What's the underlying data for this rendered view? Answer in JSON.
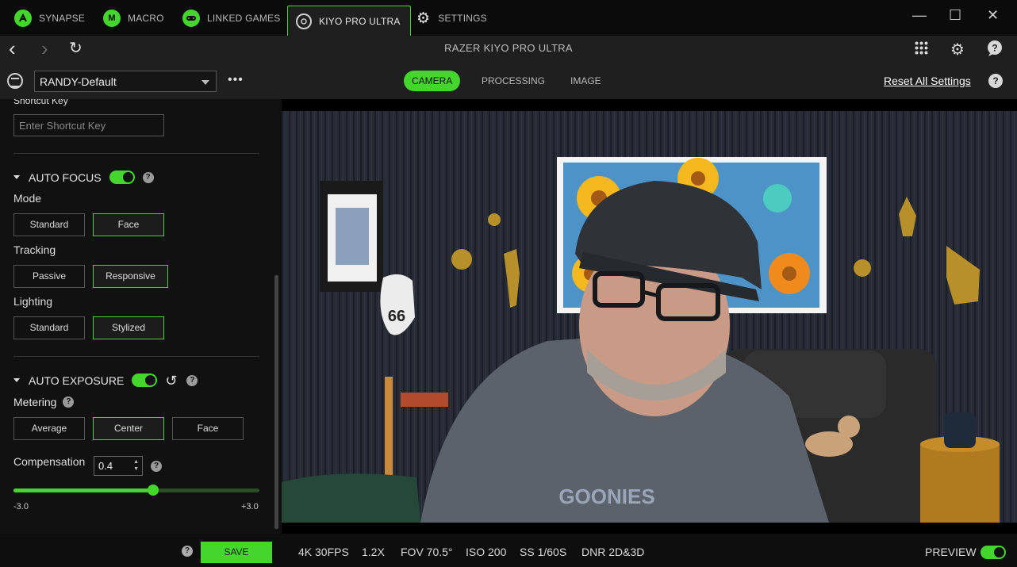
{
  "app_tabs": [
    {
      "label": "SYNAPSE",
      "icon": "razer-snake-icon"
    },
    {
      "label": "MACRO",
      "icon": "macro-m-icon"
    },
    {
      "label": "LINKED GAMES",
      "icon": "gamepad-icon"
    },
    {
      "label": "KIYO PRO ULTRA",
      "icon": "webcam-icon"
    },
    {
      "label": "SETTINGS",
      "icon": "gear-icon"
    }
  ],
  "window": {
    "minimize": "—",
    "maximize": "☐",
    "close": "✕"
  },
  "nav": {
    "title": "RAZER KIYO PRO ULTRA",
    "back": "‹",
    "forward": "›",
    "refresh": "↻"
  },
  "profile": {
    "selected": "RANDY-Default",
    "more": "•••",
    "tabs": [
      "CAMERA",
      "PROCESSING",
      "IMAGE"
    ],
    "active_tab": "CAMERA",
    "reset_label": "Reset All Settings"
  },
  "sidebar": {
    "shortcut": {
      "label": "Shortcut Key",
      "placeholder": "Enter Shortcut Key"
    },
    "auto_focus": {
      "title": "AUTO FOCUS",
      "enabled": true,
      "mode": {
        "label": "Mode",
        "options": [
          "Standard",
          "Face"
        ],
        "selected": "Face"
      },
      "tracking": {
        "label": "Tracking",
        "options": [
          "Passive",
          "Responsive"
        ],
        "selected": "Responsive"
      },
      "lighting": {
        "label": "Lighting",
        "options": [
          "Standard",
          "Stylized"
        ],
        "selected": "Stylized"
      }
    },
    "auto_exposure": {
      "title": "AUTO EXPOSURE",
      "enabled": true,
      "metering": {
        "label": "Metering",
        "options": [
          "Average",
          "Center",
          "Face"
        ],
        "selected": "Center"
      },
      "compensation": {
        "label": "Compensation",
        "value": "0.4",
        "min_label": "-3.0",
        "max_label": "+3.0",
        "min": -3.0,
        "max": 3.0,
        "current": 0.4
      }
    }
  },
  "footer": {
    "save_label": "SAVE",
    "stats": [
      "4K 30FPS",
      "1.2X",
      "FOV 70.5°",
      "ISO 200",
      "SS 1/60S",
      "DNR 2D&3D"
    ],
    "preview_label": "PREVIEW",
    "preview_enabled": true
  },
  "colors": {
    "accent": "#44d62c",
    "background": "#111111",
    "panel": "#1f1f1f"
  }
}
